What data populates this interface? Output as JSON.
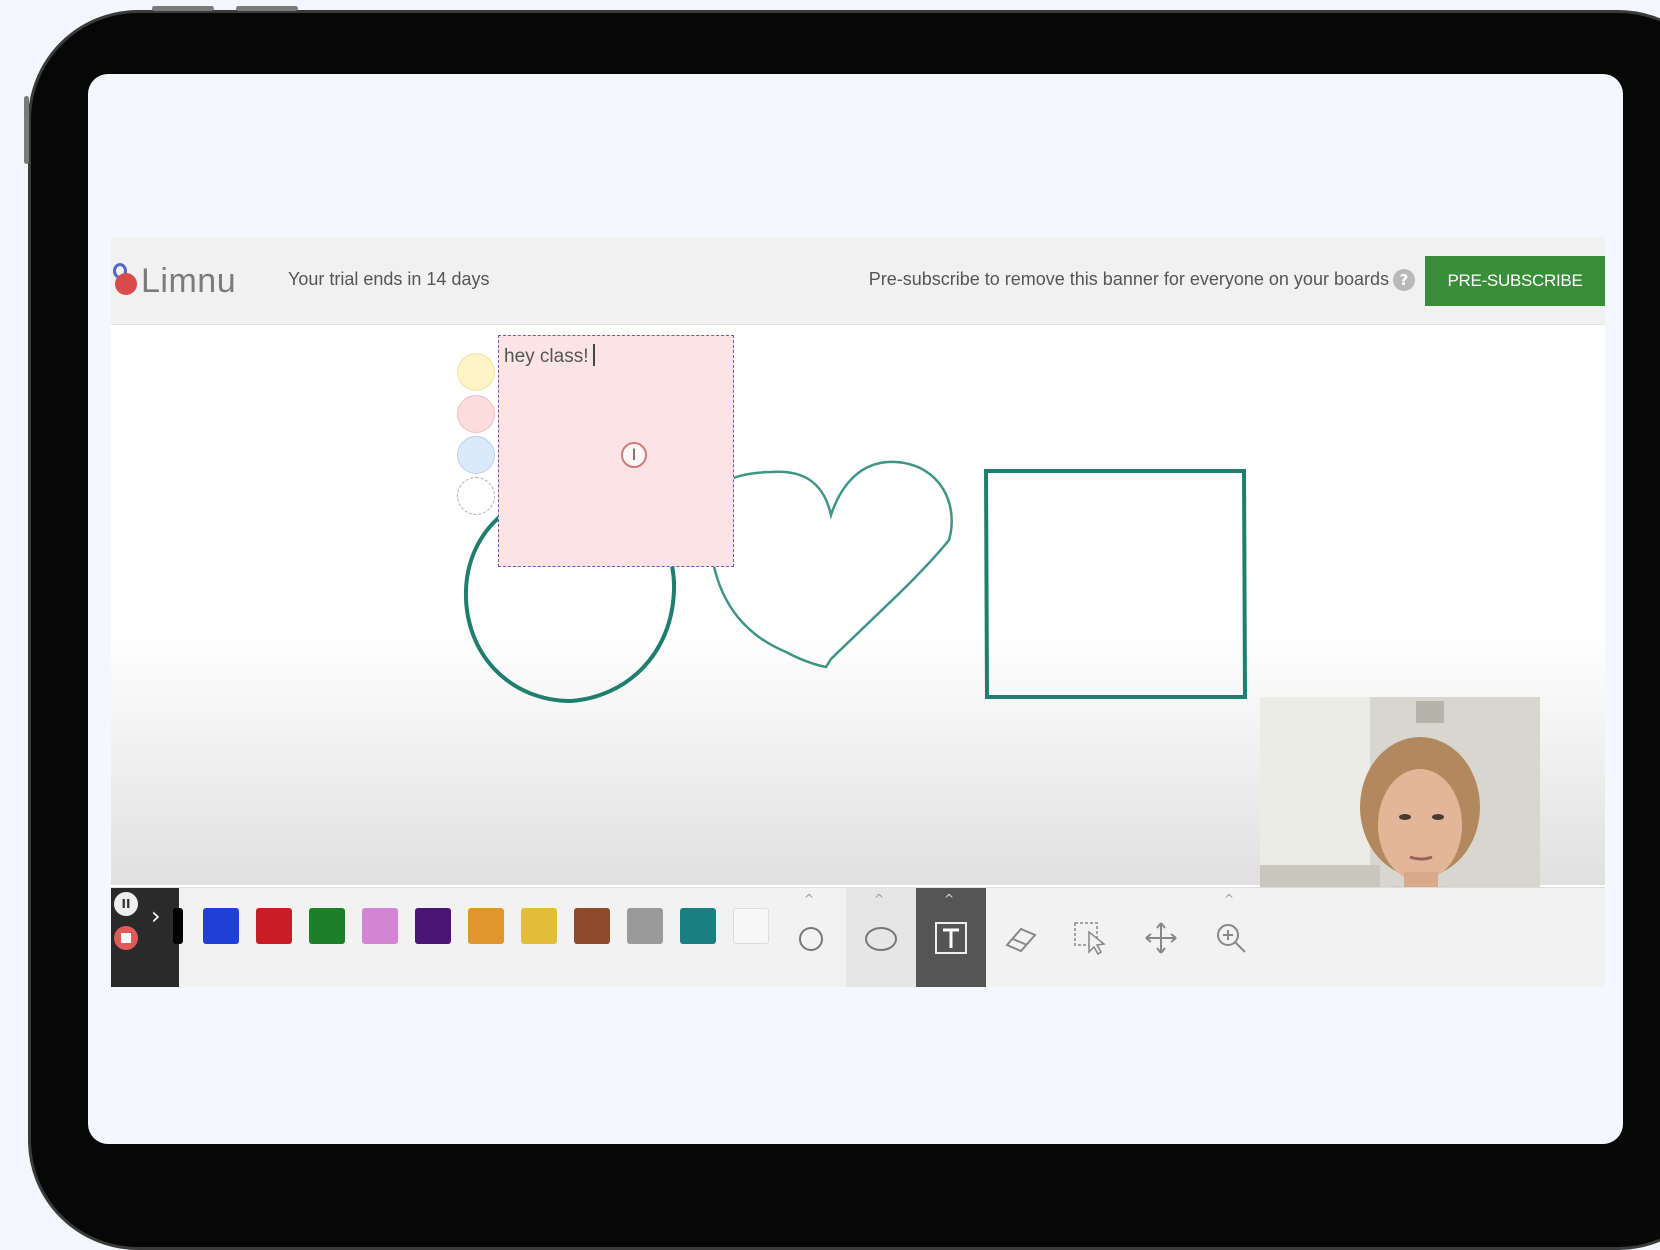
{
  "app": {
    "logo_text": "Limnu",
    "trial_text": "Your trial ends in 14 days",
    "presubscribe_message": "Pre-subscribe to remove this banner for everyone on your boards",
    "help_icon_text": "?",
    "presubscribe_button": "PRE-SUBSCRIBE"
  },
  "canvas": {
    "sticky_note": {
      "text": "hey class!",
      "color": "#fce4e6"
    },
    "sticky_colors": [
      "#fff4c6",
      "#fcdcdc",
      "#dce9fb",
      "transparent"
    ],
    "shapes": [
      {
        "kind": "circle",
        "color": "#1f7f6e"
      },
      {
        "kind": "heart",
        "color": "#3f9485"
      },
      {
        "kind": "rectangle",
        "color": "#1f7f6e"
      }
    ]
  },
  "toolbar": {
    "palette": [
      "#000000",
      "#1f3fd6",
      "#c81d25",
      "#1d7f28",
      "#d484d4",
      "#4a1575",
      "#e0962f",
      "#e2bd3a",
      "#8c4a2a",
      "#9a9a9a",
      "#1a7f7f",
      "#f7f7f7"
    ],
    "tools": [
      {
        "name": "circle-tool",
        "icon": "circle-outline"
      },
      {
        "name": "ellipse-tool",
        "icon": "ellipse-outline"
      },
      {
        "name": "text-tool",
        "icon": "T",
        "active": true
      },
      {
        "name": "eraser-tool",
        "icon": "eraser"
      },
      {
        "name": "select-tool",
        "icon": "pointer-select"
      },
      {
        "name": "move-tool",
        "icon": "move-arrows"
      },
      {
        "name": "zoom-tool",
        "icon": "zoom-in"
      }
    ],
    "expand_glyph": "›",
    "pause_glyph": "II"
  }
}
